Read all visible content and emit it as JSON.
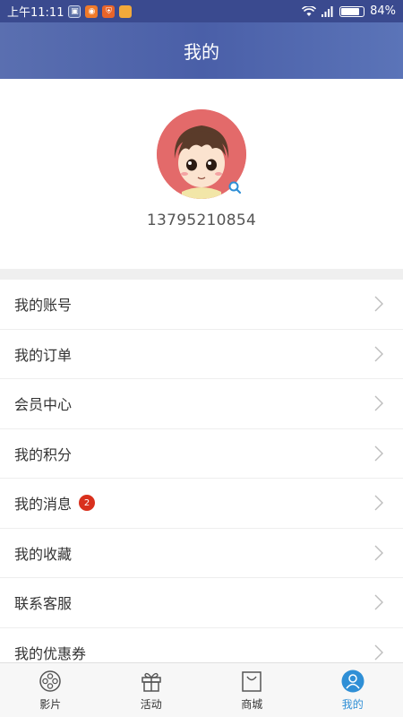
{
  "status_bar": {
    "time": "上午11:11",
    "battery_text": "84%",
    "battery_level": 0.84
  },
  "header": {
    "title": "我的"
  },
  "profile": {
    "phone": "13795210854"
  },
  "menu": [
    {
      "label": "我的账号"
    },
    {
      "label": "我的订单"
    },
    {
      "label": "会员中心"
    },
    {
      "label": "我的积分"
    },
    {
      "label": "我的消息",
      "badge": "2"
    },
    {
      "label": "我的收藏"
    },
    {
      "label": "联系客服"
    },
    {
      "label": "我的优惠券"
    }
  ],
  "tabs": [
    {
      "label": "影片",
      "icon": "film-reel-icon"
    },
    {
      "label": "活动",
      "icon": "gift-icon"
    },
    {
      "label": "商城",
      "icon": "shopping-bag-icon"
    },
    {
      "label": "我的",
      "icon": "user-icon",
      "active": true
    }
  ],
  "colors": {
    "header": "#4a5fa8",
    "active_tab": "#2f8fd6",
    "badge": "#d9301d",
    "avatar_bg": "#e36a6a"
  }
}
